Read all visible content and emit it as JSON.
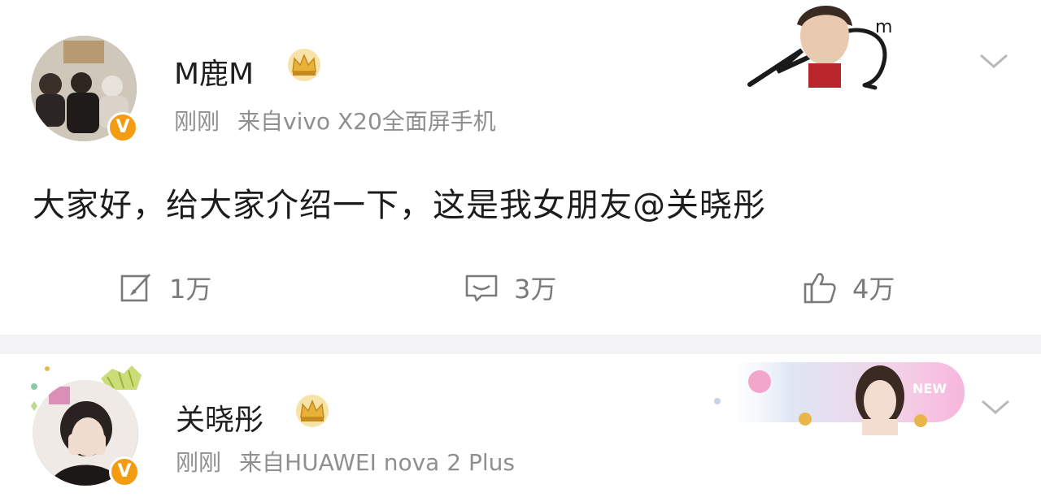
{
  "posts": [
    {
      "username": "M鹿M",
      "time": "刚刚",
      "source": "来自vivo X20全面屏手机",
      "text": "大家好，给大家介绍一下，这是我女朋友@关晓彤",
      "actions": {
        "repost_count": "1万",
        "comment_count": "3万",
        "like_count": "4万"
      },
      "badge": "V"
    },
    {
      "username": "关晓彤",
      "time": "刚刚",
      "source": "来自HUAWEI nova 2 Plus",
      "badge": "V"
    }
  ],
  "colors": {
    "background": "#f3f3f5",
    "card": "#ffffff",
    "meta_text": "#8f8f8f",
    "verified_badge": "#f39c12",
    "crown": "#e8b23a"
  },
  "icons": [
    "repost-icon",
    "comment-icon",
    "like-icon",
    "chevron-down-icon",
    "crown-icon",
    "verified-badge-icon"
  ]
}
